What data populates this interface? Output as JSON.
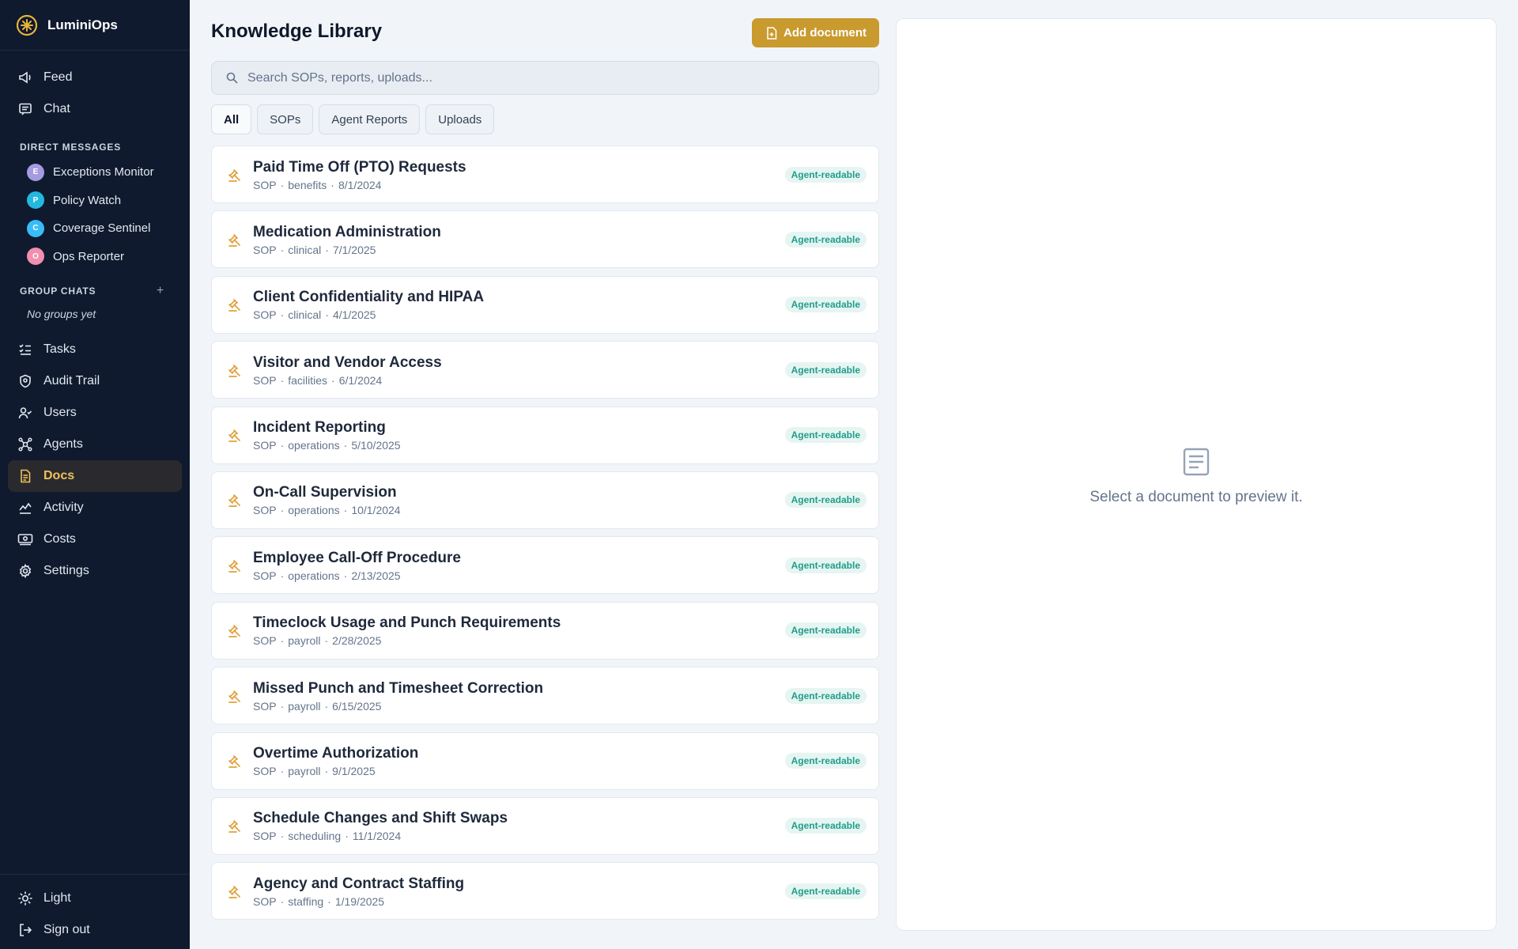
{
  "app": {
    "name": "LuminiOps"
  },
  "sidebar": {
    "nav_top": [
      {
        "label": "Feed",
        "icon": "megaphone-icon"
      },
      {
        "label": "Chat",
        "icon": "chat-icon"
      }
    ],
    "dm_label": "DIRECT MESSAGES",
    "dms": [
      {
        "label": "Exceptions Monitor",
        "initial": "E",
        "color": "#a59be0"
      },
      {
        "label": "Policy Watch",
        "initial": "P",
        "color": "#22b8e0"
      },
      {
        "label": "Coverage Sentinel",
        "initial": "C",
        "color": "#38bdf8"
      },
      {
        "label": "Ops Reporter",
        "initial": "O",
        "color": "#f08fb0"
      }
    ],
    "group_label": "GROUP CHATS",
    "group_add": "+",
    "no_groups": "No groups yet",
    "nav_main": [
      {
        "label": "Tasks",
        "icon": "checklist-icon"
      },
      {
        "label": "Audit Trail",
        "icon": "shield-icon"
      },
      {
        "label": "Users",
        "icon": "users-icon"
      },
      {
        "label": "Agents",
        "icon": "agents-icon"
      },
      {
        "label": "Docs",
        "icon": "document-icon",
        "active": true
      },
      {
        "label": "Activity",
        "icon": "activity-icon"
      },
      {
        "label": "Costs",
        "icon": "money-icon"
      },
      {
        "label": "Settings",
        "icon": "gear-icon"
      }
    ],
    "bottom": [
      {
        "label": "Light",
        "icon": "sun-icon"
      },
      {
        "label": "Sign out",
        "icon": "sign-out-icon"
      }
    ]
  },
  "main": {
    "title": "Knowledge Library",
    "add_button": "Add document",
    "search_placeholder": "Search SOPs, reports, uploads...",
    "filters": [
      "All",
      "SOPs",
      "Agent Reports",
      "Uploads"
    ],
    "active_filter": "All",
    "docs": [
      {
        "title": "Paid Time Off (PTO) Requests",
        "type": "SOP",
        "category": "benefits",
        "date": "8/1/2024",
        "badge": "Agent-readable"
      },
      {
        "title": "Medication Administration",
        "type": "SOP",
        "category": "clinical",
        "date": "7/1/2025",
        "badge": "Agent-readable"
      },
      {
        "title": "Client Confidentiality and HIPAA",
        "type": "SOP",
        "category": "clinical",
        "date": "4/1/2025",
        "badge": "Agent-readable"
      },
      {
        "title": "Visitor and Vendor Access",
        "type": "SOP",
        "category": "facilities",
        "date": "6/1/2024",
        "badge": "Agent-readable"
      },
      {
        "title": "Incident Reporting",
        "type": "SOP",
        "category": "operations",
        "date": "5/10/2025",
        "badge": "Agent-readable"
      },
      {
        "title": "On-Call Supervision",
        "type": "SOP",
        "category": "operations",
        "date": "10/1/2024",
        "badge": "Agent-readable"
      },
      {
        "title": "Employee Call-Off Procedure",
        "type": "SOP",
        "category": "operations",
        "date": "2/13/2025",
        "badge": "Agent-readable"
      },
      {
        "title": "Timeclock Usage and Punch Requirements",
        "type": "SOP",
        "category": "payroll",
        "date": "2/28/2025",
        "badge": "Agent-readable"
      },
      {
        "title": "Missed Punch and Timesheet Correction",
        "type": "SOP",
        "category": "payroll",
        "date": "6/15/2025",
        "badge": "Agent-readable"
      },
      {
        "title": "Overtime Authorization",
        "type": "SOP",
        "category": "payroll",
        "date": "9/1/2025",
        "badge": "Agent-readable"
      },
      {
        "title": "Schedule Changes and Shift Swaps",
        "type": "SOP",
        "category": "scheduling",
        "date": "11/1/2024",
        "badge": "Agent-readable"
      },
      {
        "title": "Agency and Contract Staffing",
        "type": "SOP",
        "category": "staffing",
        "date": "1/19/2025",
        "badge": "Agent-readable"
      }
    ]
  },
  "preview": {
    "empty_text": "Select a document to preview it.",
    "icon": "document-icon"
  },
  "colors": {
    "sidebar_bg": "#0f1a2e",
    "accent": "#c99a2e",
    "active_text": "#f0c15a",
    "badge_text": "#1f9d8a"
  }
}
